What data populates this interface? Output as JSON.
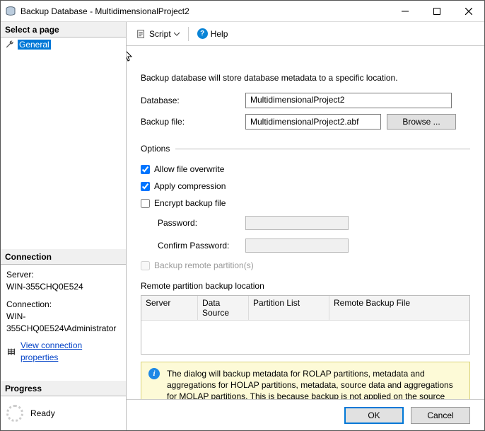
{
  "window": {
    "title": "Backup Database - MultidimensionalProject2"
  },
  "sidebar": {
    "select_page_header": "Select a page",
    "pages": [
      {
        "label": "General",
        "selected": true
      }
    ],
    "connection_header": "Connection",
    "server_label": "Server:",
    "server_value": "WIN-355CHQ0E524",
    "connection_label": "Connection:",
    "connection_value": "WIN-355CHQ0E524\\Administrator",
    "view_props_link": "View connection properties",
    "progress_header": "Progress",
    "progress_status": "Ready"
  },
  "toolbar": {
    "script_label": "Script",
    "help_label": "Help"
  },
  "content": {
    "description": "Backup database will store database metadata to a specific location.",
    "database_label": "Database:",
    "database_value": "MultidimensionalProject2",
    "backup_file_label": "Backup file:",
    "backup_file_value": "MultidimensionalProject2.abf",
    "browse_label": "Browse ...",
    "options_header": "Options",
    "allow_overwrite_label": "Allow file overwrite",
    "allow_overwrite_checked": true,
    "apply_compression_label": "Apply compression",
    "apply_compression_checked": true,
    "encrypt_label": "Encrypt backup file",
    "encrypt_checked": false,
    "password_label": "Password:",
    "confirm_password_label": "Confirm Password:",
    "backup_remote_label": "Backup remote partition(s)",
    "remote_location_label": "Remote partition backup location",
    "table_headers": {
      "server": "Server",
      "data_source": "Data Source",
      "partition_list": "Partition List",
      "remote_backup_file": "Remote Backup File"
    },
    "info_text": "The dialog will backup metadata for ROLAP partitions, metadata and aggregations for HOLAP partitions, metadata, source data and aggregations for MOLAP partitions. This is because backup is not applied on the source data contained in the relational database."
  },
  "footer": {
    "ok_label": "OK",
    "cancel_label": "Cancel"
  }
}
